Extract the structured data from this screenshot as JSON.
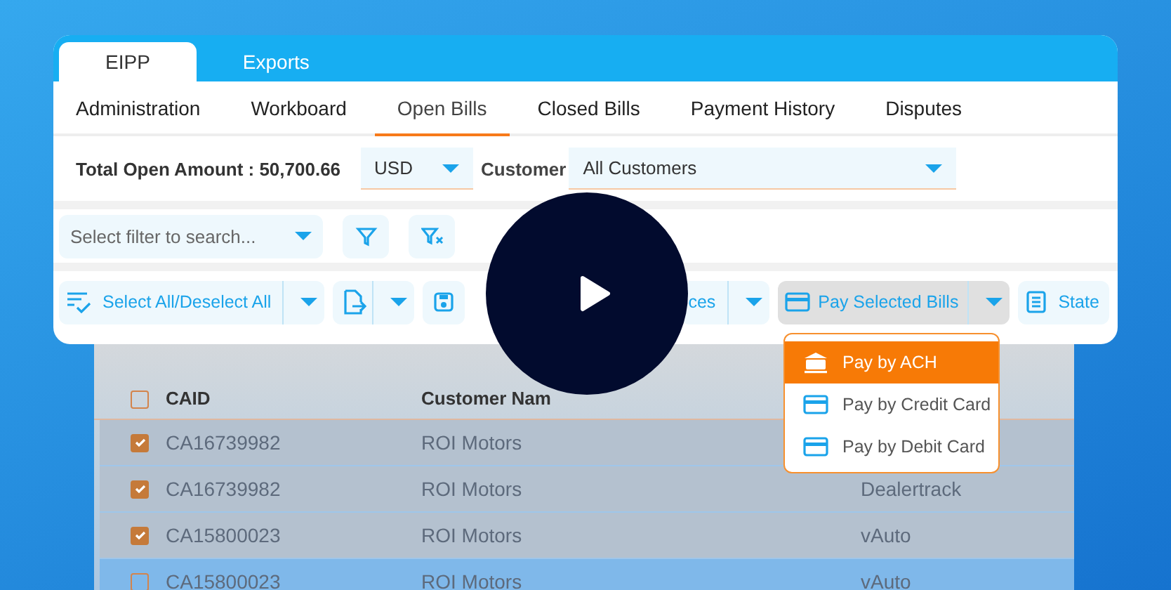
{
  "top_tabs": [
    {
      "label": "EIPP",
      "selected": true
    },
    {
      "label": "Exports",
      "selected": false
    }
  ],
  "nav_tabs": [
    {
      "label": "Administration",
      "selected": false
    },
    {
      "label": "Workboard",
      "selected": false
    },
    {
      "label": "Open Bills",
      "selected": true
    },
    {
      "label": "Closed Bills",
      "selected": false
    },
    {
      "label": "Payment History",
      "selected": false
    },
    {
      "label": "Disputes",
      "selected": false
    }
  ],
  "summary": {
    "total_label": "Total Open Amount : 50,700.66",
    "currency": "USD",
    "customer_label": "Customer",
    "customer_value": "All Customers"
  },
  "filter": {
    "placeholder": "Select filter to search..."
  },
  "toolbar": [
    {
      "kind": "split",
      "label": "Select All/Deselect All",
      "open": false
    },
    {
      "kind": "split",
      "open": false
    },
    {
      "kind": "icon"
    },
    {
      "kind": "split",
      "label": "ces",
      "open": false
    },
    {
      "kind": "split",
      "label": "Pay Selected Bills",
      "open": true
    },
    {
      "kind": "button",
      "label": "State"
    }
  ],
  "menu": [
    {
      "label": "Pay by ACH",
      "selected": true
    },
    {
      "label": "Pay by Credit Card",
      "selected": false
    },
    {
      "label": "Pay by Debit Card",
      "selected": false
    }
  ],
  "table": {
    "header_checked": false,
    "columns": [
      "CAID",
      "Customer Nam"
    ],
    "rows": [
      {
        "checked": true,
        "caid": "CA16739982",
        "customer": "ROI Motors"
      },
      {
        "checked": true,
        "caid": "CA16739982",
        "customer": "ROI Motors",
        "column_3": "Dealertrack"
      },
      {
        "checked": true,
        "caid": "CA15800023",
        "customer": "ROI Motors",
        "column_3": "vAuto"
      },
      {
        "checked": false,
        "caid": "CA15800023",
        "customer": "ROI Motors",
        "column_3": "vAuto"
      }
    ]
  }
}
